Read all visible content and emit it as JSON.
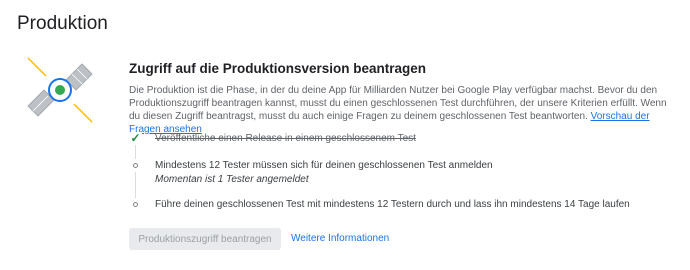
{
  "page": {
    "title": "Produktion"
  },
  "card": {
    "title": "Zugriff auf die Produktionsversion beantragen",
    "description": "Die Produktion ist die Phase, in der du deine App für Milliarden Nutzer bei Google Play verfügbar machst. Bevor du den Produktionszugriff beantragen kannst, musst du einen geschlossenen Test durchführen, der unsere Kriterien erfüllt. Wenn du diesen Zugriff beantragst, musst du auch einige Fragen zu deinem geschlossenen Test beantworten.",
    "preview_link": "Vorschau der Fragen ansehen"
  },
  "steps": [
    {
      "label": "Veröffentliche einen Release in einem geschlossenem Test",
      "status": "done"
    },
    {
      "label": "Mindestens 12 Tester müssen sich für deinen geschlossenen Test anmelden",
      "status": "pending",
      "sublabel": "Momentan ist 1 Tester angemeldet"
    },
    {
      "label": "Führe deinen geschlossenen Test mit mindestens 12 Testern durch und lass ihn mindestens 14 Tage laufen",
      "status": "pending"
    }
  ],
  "actions": {
    "request_access": "Produktionszugriff beantragen",
    "more_info": "Weitere Informationen"
  },
  "colors": {
    "accent": "#1a73e8",
    "success": "#1e8e3e",
    "illustration_green": "#34a853",
    "illustration_yellow": "#fbbc04"
  },
  "icons": {
    "illustration": "satellite-illustration",
    "done": "check-icon",
    "pending": "dot-icon"
  }
}
